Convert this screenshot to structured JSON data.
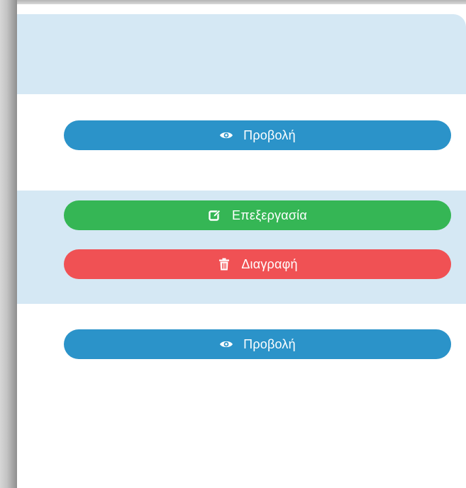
{
  "rows": [
    {
      "actions": [
        {
          "label": "Προβολή",
          "icon": "eye-icon",
          "color": "#2b93c9"
        }
      ]
    },
    {
      "actions": [
        {
          "label": "Επεξεργασία",
          "icon": "edit-icon",
          "color": "#35b655"
        },
        {
          "label": "Διαγραφή",
          "icon": "trash-icon",
          "color": "#f05154"
        }
      ]
    },
    {
      "actions": [
        {
          "label": "Προβολή",
          "icon": "eye-icon",
          "color": "#2b93c9"
        }
      ]
    }
  ],
  "colors": {
    "row_highlight": "#d5e8f4",
    "frame_border": "#a9a9a9"
  }
}
